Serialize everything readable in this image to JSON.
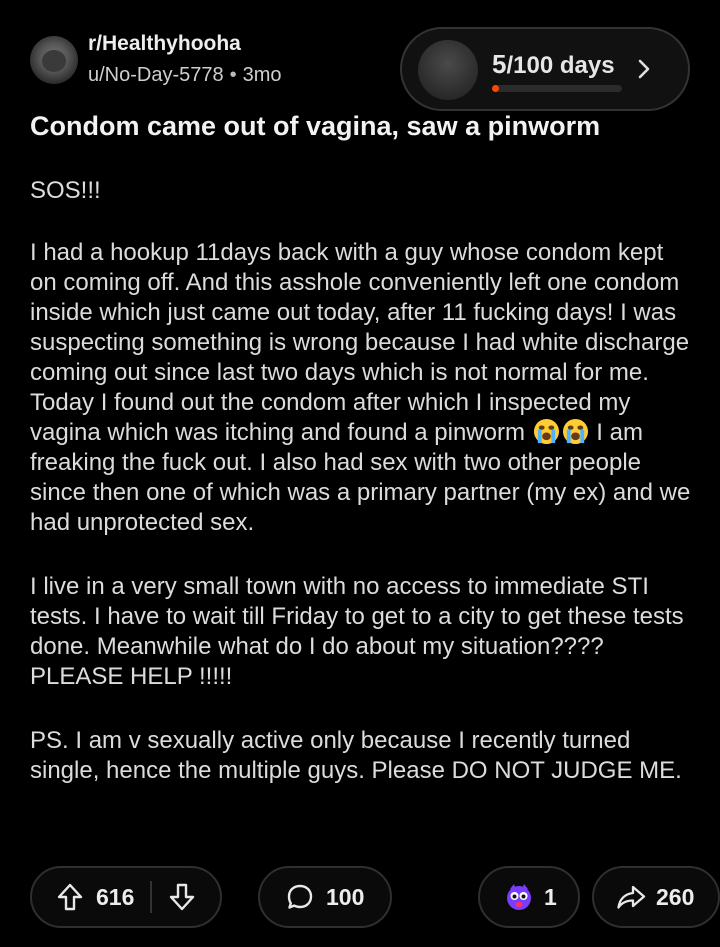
{
  "post": {
    "subreddit": "r/Healthyhooha",
    "author": "u/No-Day-5778",
    "separator": "•",
    "age": "3mo",
    "title": "Condom came out of vagina, saw a pinworm",
    "body": {
      "p1": "SOS!!!",
      "p2_part1": "I had a hookup 11days back with a guy whose condom kept on coming off. And this asshole conveniently left one condom inside which just came out today, after 11 fucking days! I was suspecting something is wrong because I had white discharge coming out since last two days which is not normal for me. Today I found out the condom after which I inspected my vagina which was itching and found a pinworm ",
      "p2_part2": " I am freaking the fuck out. I also had sex with two other people since then one of which was a primary partner (my ex) and we had unprotected sex.",
      "p3": "I live in a very small town with no access to immediate STI tests. I have to wait till Friday to get to a city to get these tests done. Meanwhile what do I do about my situation???? PLEASE HELP !!!!!",
      "p4": "PS. I am v sexually active only because I recently turned single, hence the multiple guys. Please DO NOT JUDGE ME."
    }
  },
  "streak": {
    "current": "5",
    "total_label": "/100 days",
    "progress": 0.05,
    "accent": "#ff4500"
  },
  "actions": {
    "upvotes": "616",
    "comments": "100",
    "awards": "1",
    "shares": "260"
  },
  "icons": {
    "upvote": "arrow-up-icon",
    "downvote": "arrow-down-icon",
    "comment": "speech-bubble-icon",
    "award": "award-badge-icon",
    "share": "share-arrow-icon",
    "emoji": "loudly-crying-face-emoji"
  }
}
